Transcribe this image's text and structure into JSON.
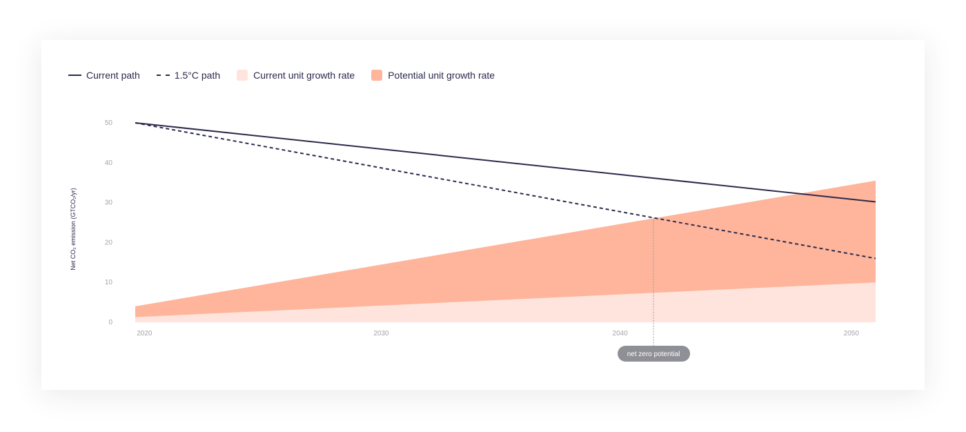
{
  "legend": {
    "current_path": "Current path",
    "path_15": "1.5°C path",
    "current_growth": "Current unit growth rate",
    "potential_growth": "Potential unit growth rate"
  },
  "colors": {
    "line": "#2b2a4c",
    "current_growth_fill": "#fee4dc",
    "potential_growth_fill": "#feb59b",
    "annotation_bg": "#8f8f96"
  },
  "chart_data": {
    "type": "area",
    "ylabel": "Net CO₂ emission (GTCO₂/yr)",
    "xlim": [
      2019.7,
      2050.7
    ],
    "ylim": [
      0,
      50
    ],
    "x_ticks": [
      2020,
      2030,
      2040,
      2050
    ],
    "y_ticks": [
      0,
      10,
      20,
      30,
      40,
      50
    ],
    "series": [
      {
        "name": "Current path",
        "kind": "line",
        "x": [
          2019.7,
          2050.7
        ],
        "y": [
          50,
          30.2
        ]
      },
      {
        "name": "1.5°C path",
        "kind": "dashed-line",
        "x": [
          2019.7,
          2050.7
        ],
        "y": [
          50,
          16
        ]
      },
      {
        "name": "Current unit growth rate",
        "kind": "area",
        "x": [
          2019.7,
          2050.7
        ],
        "y": [
          1.3,
          10
        ]
      },
      {
        "name": "Potential unit growth rate",
        "kind": "area",
        "x": [
          2019.7,
          2050.7
        ],
        "y": [
          4,
          35.5
        ]
      }
    ],
    "annotation": {
      "text": "net zero potential",
      "x": 2041.4
    }
  }
}
